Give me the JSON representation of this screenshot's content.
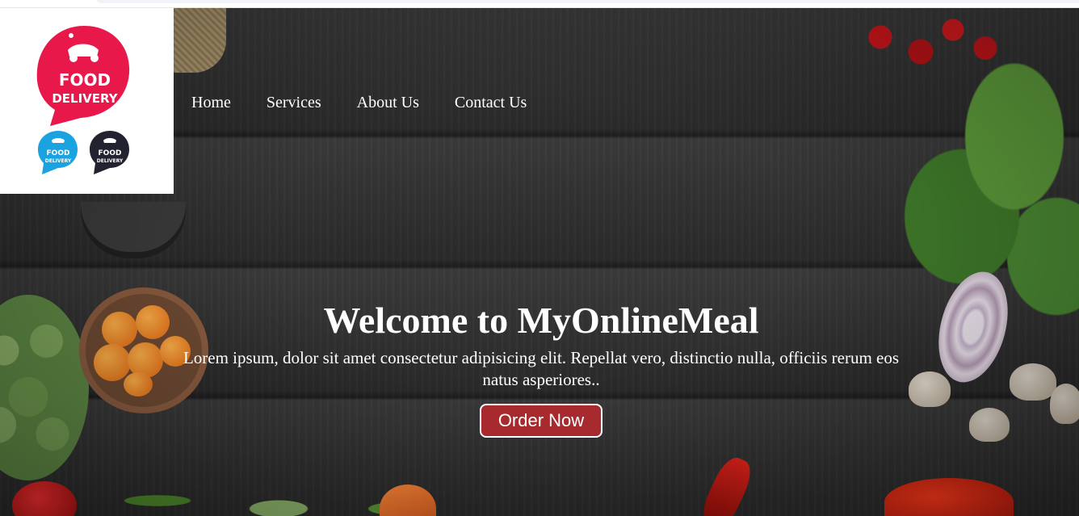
{
  "logo": {
    "main_line1": "FOOD",
    "main_line2": "DELIVERY",
    "small_line1": "FOOD",
    "small_line2": "DELIVERY",
    "brand_color": "#e8194a",
    "alt_color_1": "#1aa3e0",
    "alt_color_2": "#222230"
  },
  "nav": {
    "items": [
      {
        "label": "Home"
      },
      {
        "label": "Services"
      },
      {
        "label": "About Us"
      },
      {
        "label": "Contact Us"
      }
    ]
  },
  "hero": {
    "title": "Welcome to MyOnlineMeal",
    "subtitle": "Lorem ipsum, dolor sit amet consectetur adipisicing elit. Repellat vero, distinctio nulla, officiis rerum eos natus asperiores..",
    "cta_label": "Order Now",
    "cta_color": "#a72b2e"
  }
}
